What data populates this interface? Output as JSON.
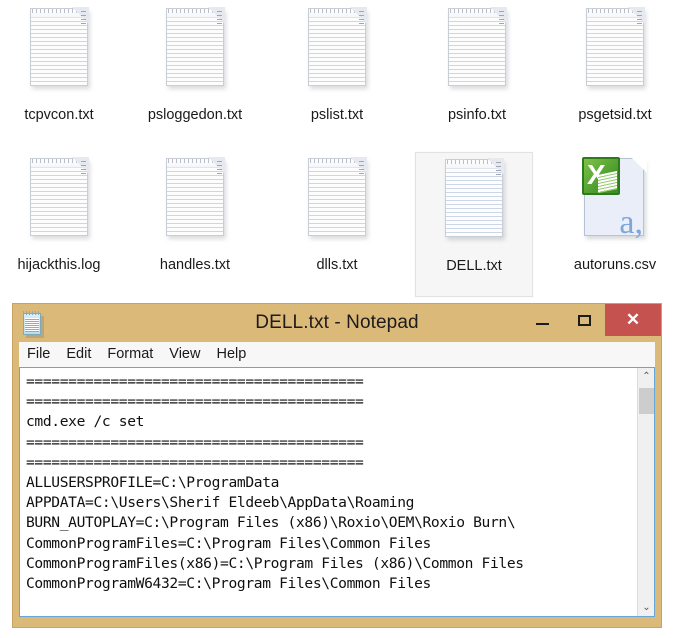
{
  "files": {
    "row1": [
      {
        "name": "tcpvcon.txt",
        "icon": "text-file-icon",
        "selected": false
      },
      {
        "name": "psloggedon.txt",
        "icon": "text-file-icon",
        "selected": false
      },
      {
        "name": "pslist.txt",
        "icon": "text-file-icon",
        "selected": false
      },
      {
        "name": "psinfo.txt",
        "icon": "text-file-icon",
        "selected": false
      },
      {
        "name": "psgetsid.txt",
        "icon": "text-file-icon",
        "selected": false
      }
    ],
    "row2": [
      {
        "name": "hijackthis.log",
        "icon": "text-file-icon",
        "selected": false
      },
      {
        "name": "handles.txt",
        "icon": "text-file-icon",
        "selected": false
      },
      {
        "name": "dlls.txt",
        "icon": "text-file-icon",
        "selected": false
      },
      {
        "name": "DELL.txt",
        "icon": "text-file-icon",
        "selected": true
      },
      {
        "name": "autoruns.csv",
        "icon": "excel-csv-icon",
        "selected": false
      }
    ]
  },
  "window": {
    "title": "DELL.txt - Notepad",
    "icon": "notepad-icon",
    "titlebar_color": "#dbb978",
    "close_button_color": "#c5524f",
    "buttons": {
      "minimize": "—",
      "maximize": "□",
      "close": "✕"
    },
    "menu": [
      {
        "label": "File"
      },
      {
        "label": "Edit"
      },
      {
        "label": "Format"
      },
      {
        "label": "View"
      },
      {
        "label": "Help"
      }
    ],
    "editor": {
      "content": "========================================\n========================================\ncmd.exe /c set\n========================================\n========================================\nALLUSERSPROFILE=C:\\ProgramData\nAPPDATA=C:\\Users\\Sherif Eldeeb\\AppData\\Roaming\nBURN_AUTOPLAY=C:\\Program Files (x86)\\Roxio\\OEM\\Roxio Burn\\\nCommonProgramFiles=C:\\Program Files\\Common Files\nCommonProgramFiles(x86)=C:\\Program Files (x86)\\Common Files\nCommonProgramW6432=C:\\Program Files\\Common Files",
      "lines": [
        "========================================",
        "========================================",
        "cmd.exe /c set",
        "========================================",
        "========================================",
        "ALLUSERSPROFILE=C:\\ProgramData",
        "APPDATA=C:\\Users\\Sherif Eldeeb\\AppData\\Roaming",
        "BURN_AUTOPLAY=C:\\Program Files (x86)\\Roxio\\OEM\\Roxio Burn\\",
        "CommonProgramFiles=C:\\Program Files\\Common Files",
        "CommonProgramFiles(x86)=C:\\Program Files (x86)\\Common Files",
        "CommonProgramW6432=C:\\Program Files\\Common Files"
      ]
    },
    "scrollbar": {
      "up_arrow": "⌃",
      "down_arrow": "⌄"
    }
  }
}
